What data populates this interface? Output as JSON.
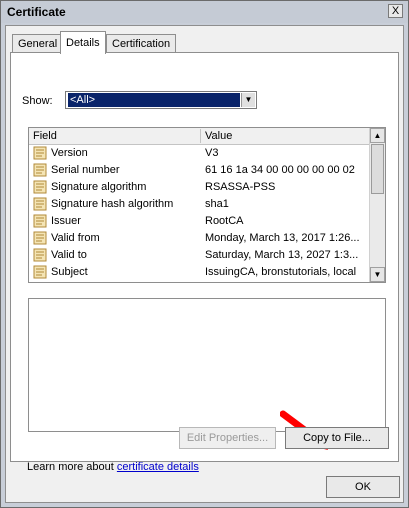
{
  "window": {
    "title": "Certificate",
    "close_label": "X"
  },
  "tabs": [
    {
      "label": "General"
    },
    {
      "label": "Details"
    },
    {
      "label": "Certification Path"
    }
  ],
  "show": {
    "label": "Show:",
    "value": "<All>"
  },
  "list": {
    "columns": [
      "Field",
      "Value"
    ],
    "rows": [
      {
        "field": "Version",
        "value": "V3"
      },
      {
        "field": "Serial number",
        "value": "61 16 1a 34 00 00 00 00 00 02"
      },
      {
        "field": "Signature algorithm",
        "value": "RSASSA-PSS"
      },
      {
        "field": "Signature hash algorithm",
        "value": "sha1"
      },
      {
        "field": "Issuer",
        "value": "RootCA"
      },
      {
        "field": "Valid from",
        "value": "Monday, March 13, 2017 1:26..."
      },
      {
        "field": "Valid to",
        "value": "Saturday, March 13, 2027 1:3..."
      },
      {
        "field": "Subject",
        "value": "IssuingCA, bronstutorials, local"
      }
    ]
  },
  "buttons": {
    "edit_properties": "Edit Properties...",
    "copy_to_file": "Copy to File...",
    "ok": "OK"
  },
  "learn_more": {
    "prefix": "Learn more about ",
    "link": "certificate details"
  },
  "colors": {
    "selection": "#0a246a",
    "arrow": "#ff0000",
    "link": "#0000cc"
  }
}
